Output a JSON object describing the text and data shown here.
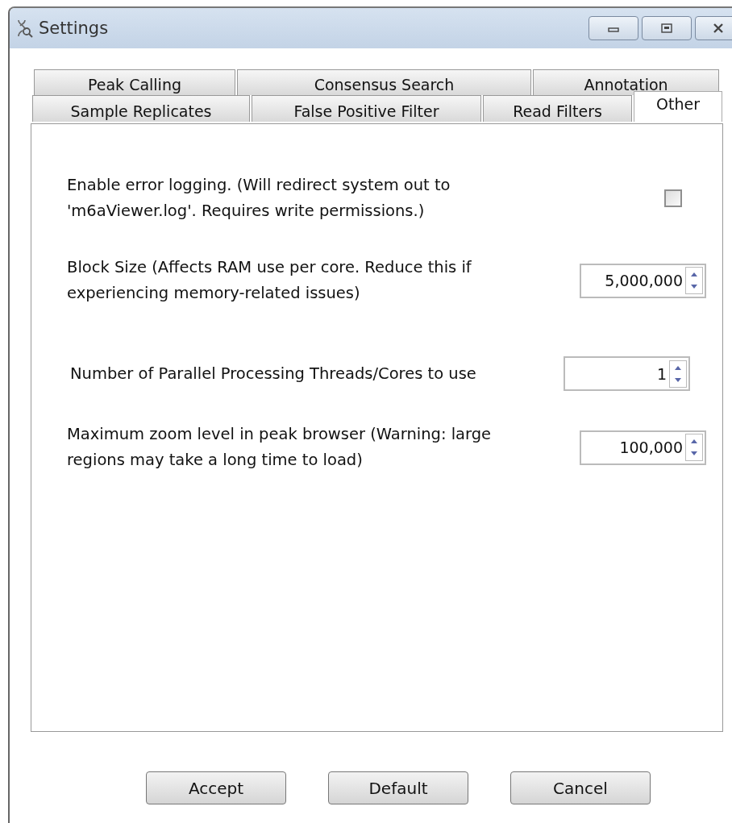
{
  "window": {
    "title": "Settings"
  },
  "tab_rows": [
    {
      "tabs": [
        {
          "label": "Peak Calling",
          "selected": false
        },
        {
          "label": "Consensus Search",
          "selected": false
        },
        {
          "label": "Annotation",
          "selected": false
        }
      ]
    },
    {
      "tabs": [
        {
          "label": "Sample Replicates",
          "selected": false
        },
        {
          "label": "False Positive Filter",
          "selected": false
        },
        {
          "label": "Read Filters",
          "selected": false
        },
        {
          "label": "Other",
          "selected": true
        }
      ]
    }
  ],
  "options": [
    {
      "kind": "checkbox",
      "label": "Enable error logging. (Will redirect system out to 'm6aViewer.log'. Requires write permissions.)",
      "checked": false
    },
    {
      "kind": "spinner",
      "label": "Block Size (Affects RAM use per core. Reduce this if experiencing memory-related issues)",
      "value": "5,000,000"
    },
    {
      "kind": "spinner",
      "label": "Number of Parallel Processing Threads/Cores to use",
      "value": "1"
    },
    {
      "kind": "spinner",
      "label": "Maximum zoom level in peak browser (Warning: large regions may take a long time to load)",
      "value": "100,000"
    }
  ],
  "buttons": [
    "Accept",
    "Default",
    "Cancel"
  ]
}
